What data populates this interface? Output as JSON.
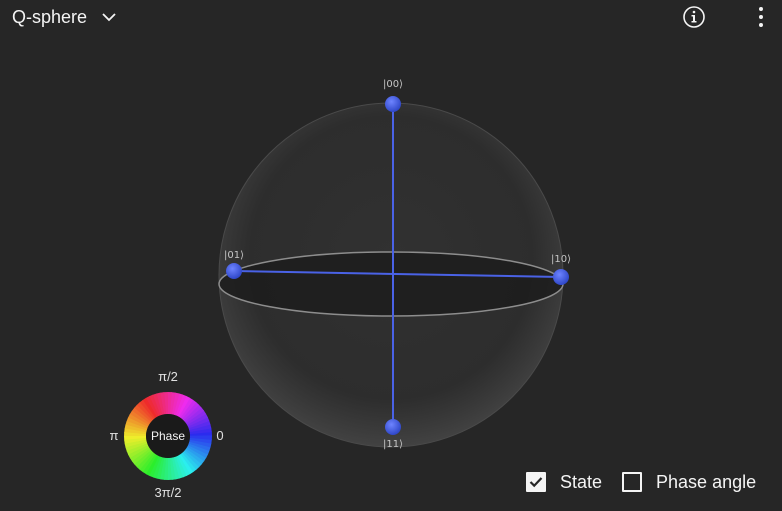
{
  "header": {
    "view_title": "Q-sphere",
    "icons": {
      "dropdown": "chevron-down-icon",
      "info": "info-icon",
      "more": "overflow-menu-vertical-icon"
    }
  },
  "qsphere": {
    "states": [
      {
        "label": "|00⟩"
      },
      {
        "label": "|01⟩"
      },
      {
        "label": "|10⟩"
      },
      {
        "label": "|11⟩"
      }
    ],
    "node_color": "#3d58d6",
    "line_color": "#4a62e6"
  },
  "phase_wheel": {
    "center_label": "Phase",
    "top_label": "π/2",
    "left_label": "π",
    "right_label": "0",
    "bottom_label": "3π/2"
  },
  "legend": {
    "state": {
      "label": "State",
      "checked": true
    },
    "phase_angle": {
      "label": "Phase angle",
      "checked": false
    }
  },
  "colors": {
    "background": "#262626",
    "text": "#f4f4f4"
  }
}
